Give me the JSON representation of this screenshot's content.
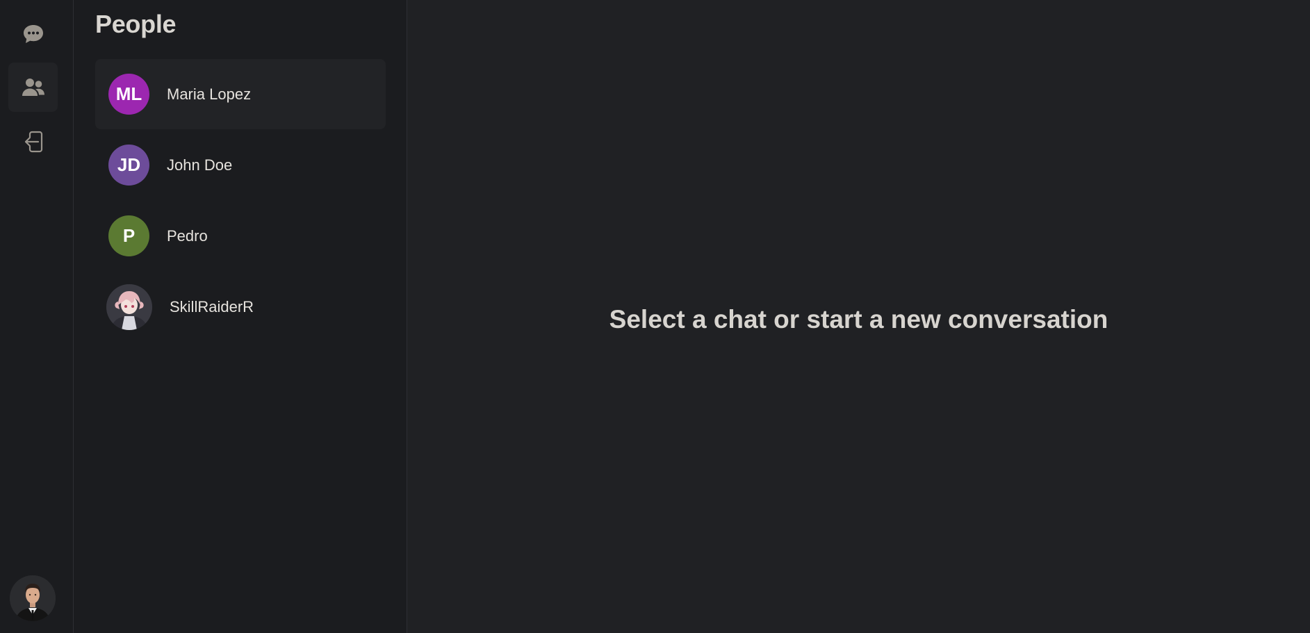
{
  "nav": {
    "items": [
      {
        "icon": "chat-icon"
      },
      {
        "icon": "people-icon",
        "active": true
      },
      {
        "icon": "logout-icon"
      }
    ],
    "user_avatar": "user-avatar-photo"
  },
  "people": {
    "title": "People",
    "contacts": [
      {
        "name": "Maria Lopez",
        "initials": "ML",
        "color": "#9c27b0",
        "active": true
      },
      {
        "name": "John Doe",
        "initials": "JD",
        "color": "#6d4c9a"
      },
      {
        "name": "Pedro",
        "initials": "P",
        "color": "#5b7a32"
      },
      {
        "name": "SkillRaiderR",
        "initials": "",
        "avatar": "anime-character-photo"
      }
    ]
  },
  "main": {
    "empty_message": "Select a chat or start a new conversation"
  },
  "colors": {
    "background": "#202124",
    "sidebar": "#1b1c1f",
    "active_item": "#222326",
    "icon": "#9a958d"
  }
}
